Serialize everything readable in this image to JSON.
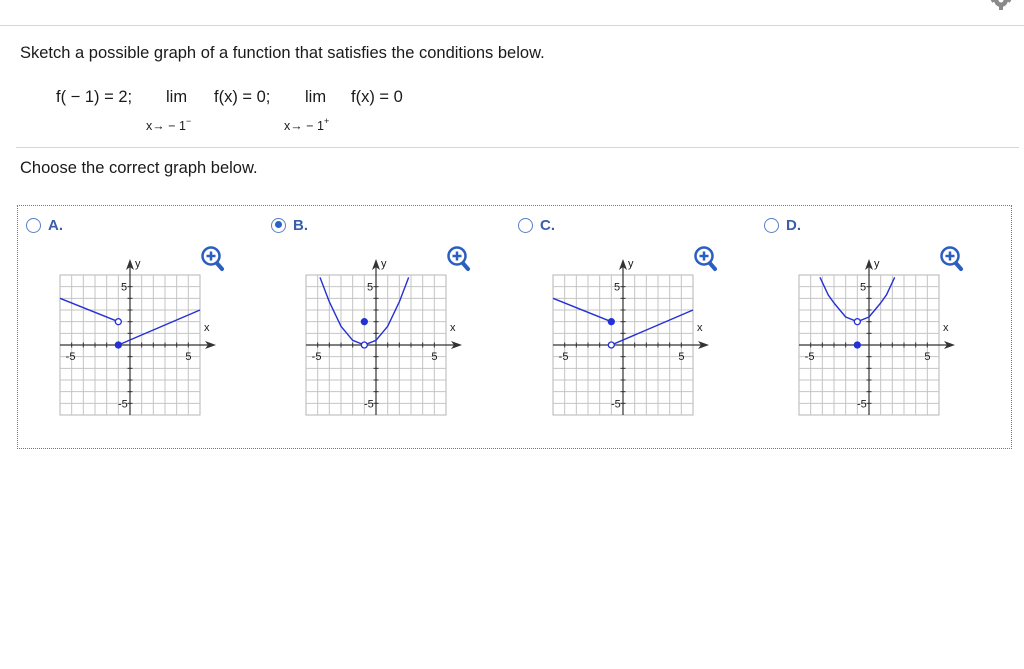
{
  "header": {
    "gear_icon": "gear-icon"
  },
  "question": {
    "prompt": "Sketch a possible graph of a function that satisfies the conditions below.",
    "cond1": "f( − 1) = 2;",
    "lim1_word": "lim",
    "lim1_expr": "f(x) = 0;",
    "lim1_sub": "x→ − 1",
    "lim1_sup": "−",
    "lim2_word": "lim",
    "lim2_expr": "f(x) = 0",
    "lim2_sub": "x→ − 1",
    "lim2_sup": "+"
  },
  "instruction": "Choose the correct graph below.",
  "selected_option": "B",
  "accent_color": "#2b62c6",
  "curve_color": "#2530d6",
  "options": [
    {
      "letter": "A.",
      "labels": {
        "x": "x",
        "y": "y",
        "xmin": "-5",
        "xmax": "5",
        "ymax": "5",
        "ymin": "-5"
      },
      "chart_data": {
        "type": "line",
        "xlim": [
          -6,
          6
        ],
        "ylim": [
          -6,
          6
        ],
        "grid": true,
        "series": [
          {
            "points": [
              [
                -6,
                4
              ],
              [
                -1,
                2
              ]
            ]
          },
          {
            "points": [
              [
                -1,
                0
              ],
              [
                6,
                3
              ]
            ]
          }
        ],
        "points": [
          {
            "x": -1,
            "y": 2,
            "filled": false
          },
          {
            "x": -1,
            "y": 0,
            "filled": true
          }
        ]
      }
    },
    {
      "letter": "B.",
      "labels": {
        "x": "x",
        "y": "y",
        "xmin": "-5",
        "xmax": "5",
        "ymax": "5",
        "ymin": "-5"
      },
      "chart_data": {
        "type": "line",
        "xlim": [
          -6,
          6
        ],
        "ylim": [
          -6,
          6
        ],
        "grid": true,
        "series": [
          {
            "points": [
              [
                -4.8,
                5.8
              ],
              [
                -4,
                3.7
              ],
              [
                -3,
                1.6
              ],
              [
                -2,
                0.4
              ],
              [
                -1,
                0
              ],
              [
                0,
                0.4
              ],
              [
                1,
                1.6
              ],
              [
                2,
                3.7
              ],
              [
                2.8,
                5.8
              ]
            ]
          }
        ],
        "points": [
          {
            "x": -1,
            "y": 0,
            "filled": false
          },
          {
            "x": -1,
            "y": 2,
            "filled": true
          }
        ]
      }
    },
    {
      "letter": "C.",
      "labels": {
        "x": "x",
        "y": "y",
        "xmin": "-5",
        "xmax": "5",
        "ymax": "5",
        "ymin": "-5"
      },
      "chart_data": {
        "type": "line",
        "xlim": [
          -6,
          6
        ],
        "ylim": [
          -6,
          6
        ],
        "grid": true,
        "series": [
          {
            "points": [
              [
                -6,
                4
              ],
              [
                -1,
                2
              ]
            ]
          },
          {
            "points": [
              [
                -1,
                0
              ],
              [
                6,
                3
              ]
            ]
          }
        ],
        "points": [
          {
            "x": -1,
            "y": 2,
            "filled": true
          },
          {
            "x": -1,
            "y": 0,
            "filled": false
          }
        ]
      }
    },
    {
      "letter": "D.",
      "labels": {
        "x": "x",
        "y": "y",
        "xmin": "-5",
        "xmax": "5",
        "ymax": "5",
        "ymin": "-5"
      },
      "chart_data": {
        "type": "line",
        "xlim": [
          -6,
          6
        ],
        "ylim": [
          -6,
          6
        ],
        "grid": true,
        "series": [
          {
            "points": [
              [
                -4.2,
                5.8
              ],
              [
                -3.5,
                4.3
              ],
              [
                -3,
                3.6
              ],
              [
                -2,
                2.4
              ],
              [
                -1,
                2
              ],
              [
                0,
                2.4
              ],
              [
                1,
                3.6
              ],
              [
                1.5,
                4.3
              ],
              [
                2.2,
                5.8
              ]
            ]
          }
        ],
        "points": [
          {
            "x": -1,
            "y": 2,
            "filled": false
          },
          {
            "x": -1,
            "y": 0,
            "filled": true
          }
        ]
      }
    }
  ]
}
